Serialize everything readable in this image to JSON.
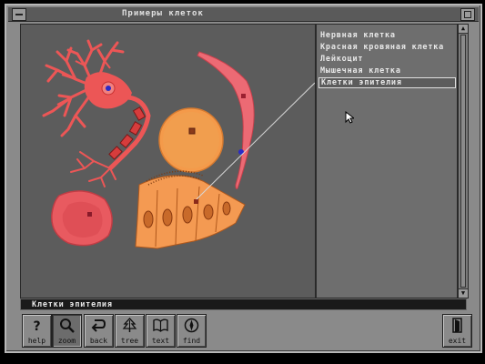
{
  "window": {
    "title": "Примеры клеток"
  },
  "list": {
    "items": [
      {
        "label": "Нервная клетка",
        "selected": false
      },
      {
        "label": "Красная кровяная клетка",
        "selected": false
      },
      {
        "label": "Лейкоцит",
        "selected": false
      },
      {
        "label": "Мышечная клетка",
        "selected": false
      },
      {
        "label": "Клетки эпителия",
        "selected": true
      }
    ]
  },
  "caption": {
    "text": "Клетки эпителия"
  },
  "toolbar": {
    "help": {
      "label": "help",
      "icon": "question-icon"
    },
    "zoom": {
      "label": "zoom",
      "icon": "magnifier-icon"
    },
    "back": {
      "label": "back",
      "icon": "return-arrow-icon"
    },
    "tree": {
      "label": "tree",
      "icon": "tree-icon"
    },
    "text": {
      "label": "text",
      "icon": "open-book-icon"
    },
    "find": {
      "label": "find",
      "icon": "compass-icon"
    },
    "exit": {
      "label": "exit",
      "icon": "door-icon"
    }
  },
  "colors": {
    "neuron": "#ec5656",
    "red_cell": "#e85a60",
    "leukocyte": "#f49a4a",
    "muscle": "#ec6a74",
    "epithelium": "#f49a52",
    "nucleus": "#2a2ac8"
  }
}
